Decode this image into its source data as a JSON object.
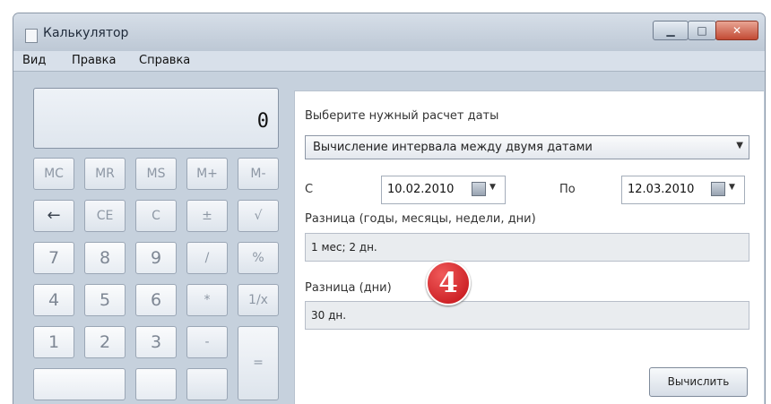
{
  "window": {
    "title": "Калькулятор"
  },
  "menu": [
    "Вид",
    "Правка",
    "Справка"
  ],
  "display": {
    "value": "0"
  },
  "memory_keys": [
    "MC",
    "MR",
    "MS",
    "M+",
    "M-"
  ],
  "function_keys": [
    "←",
    "CE",
    "C",
    "±",
    "√"
  ],
  "rows": [
    [
      "7",
      "8",
      "9",
      "/",
      "%"
    ],
    [
      "4",
      "5",
      "6",
      "*",
      "1/x"
    ],
    [
      "1",
      "2",
      "3",
      "-"
    ]
  ],
  "equals_key": "=",
  "date_panel": {
    "prompt": "Выберите нужный расчет даты",
    "mode": "Вычисление интервала между двумя датами",
    "from_label": "С",
    "from_date": "10.02.2010",
    "to_label": "По",
    "to_date": "12.03.2010",
    "diff_label": "Разница (годы, месяцы, недели, дни)",
    "diff_value": "1 мес; 2 дн.",
    "days_label": "Разница (дни)",
    "days_value": "30 дн.",
    "calculate_button": "Вычислить"
  },
  "badge": "4",
  "colors": {
    "badge": "#c10e14",
    "window_frame": "#c9d3df"
  }
}
